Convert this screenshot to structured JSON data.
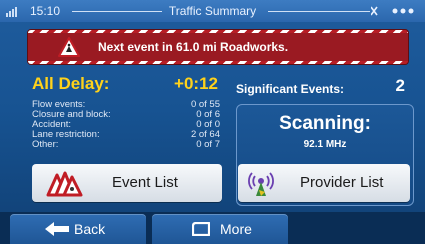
{
  "status_bar": {
    "time": "15:10",
    "title": "Traffic Summary",
    "menu_glyph": "⋯",
    "signal_icon": "signal-bars-icon",
    "menu_icon": "menu-dots-icon"
  },
  "banner": {
    "text": "Next event in 61.0 mi Roadworks.",
    "icon": "roadworks-warning-icon",
    "color": "#9a1a22"
  },
  "delay": {
    "label": "All Delay:",
    "value": "+0:12",
    "color": "#ffd21a"
  },
  "stats": [
    {
      "label": "Flow events:",
      "value": "0 of 55"
    },
    {
      "label": "Closure and block:",
      "value": "0 of 6"
    },
    {
      "label": "Accident:",
      "value": "0 of 0"
    },
    {
      "label": "Lane restriction:",
      "value": "2 of 64"
    },
    {
      "label": "Other:",
      "value": "0 of 7"
    }
  ],
  "significant_events": {
    "label": "Significant Events:",
    "value": "2"
  },
  "scanning": {
    "title": "Scanning:",
    "frequency": "92.1 MHz"
  },
  "buttons": {
    "event_list": {
      "label": "Event List",
      "icon": "warning-signs-icon"
    },
    "provider_list": {
      "label": "Provider List",
      "icon": "radio-antenna-icon"
    }
  },
  "bottom": {
    "back": {
      "label": "Back",
      "icon": "arrow-left-icon"
    },
    "more": {
      "label": "More",
      "icon": "rounded-square-icon"
    }
  }
}
